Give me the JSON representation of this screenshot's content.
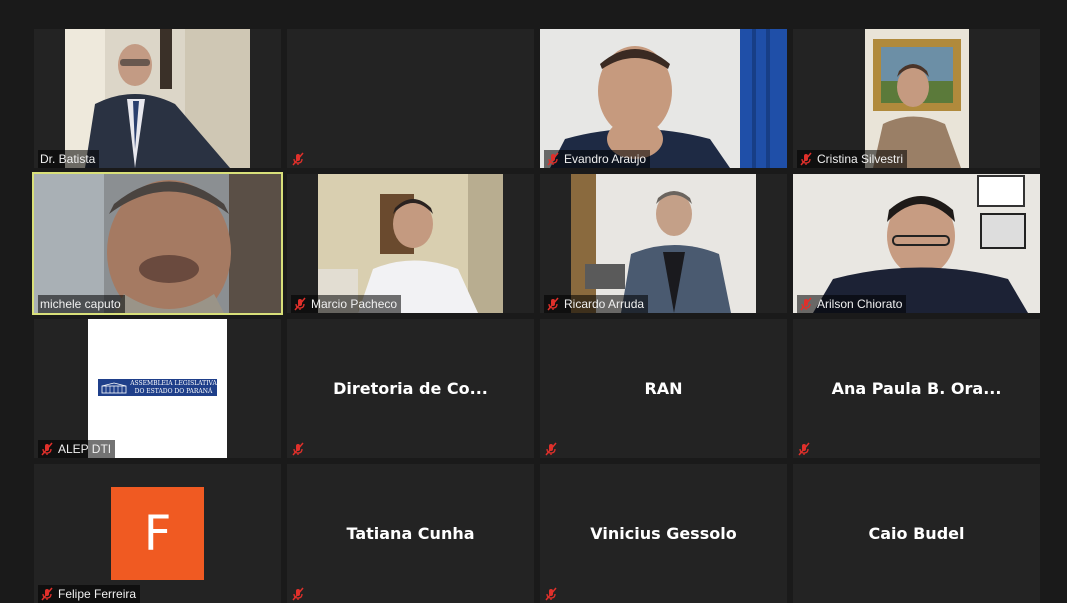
{
  "participants": [
    {
      "name": "Dr. Batista",
      "video": true,
      "muted": false
    },
    {
      "name": "",
      "video": false,
      "muted": true
    },
    {
      "name": "Evandro Araujo",
      "video": true,
      "muted": true
    },
    {
      "name": "Cristina Silvestri",
      "video": true,
      "muted": true
    },
    {
      "name": "michele caputo",
      "video": true,
      "muted": false,
      "speaking": true
    },
    {
      "name": "Marcio Pacheco",
      "video": true,
      "muted": true
    },
    {
      "name": "Ricardo Arruda",
      "video": true,
      "muted": true
    },
    {
      "name": "Arilson Chiorato",
      "video": true,
      "muted": true
    },
    {
      "name": "ALEP DTI",
      "video": true,
      "muted": true,
      "logo_text": "ASSEMBLEIA LEGISLATIVA DO ESTADO DO PARANÁ"
    },
    {
      "name": "Diretoria de Co...",
      "video": false,
      "muted": true
    },
    {
      "name": "RAN",
      "video": false,
      "muted": true
    },
    {
      "name": "Ana Paula B. Ora...",
      "video": false,
      "muted": true
    },
    {
      "name": "Felipe Ferreira",
      "video": false,
      "muted": true,
      "avatar_letter": "F",
      "avatar_color": "#f05a22"
    },
    {
      "name": "Tatiana Cunha",
      "video": false,
      "muted": true
    },
    {
      "name": "Vinicius Gessolo",
      "video": false,
      "muted": true
    },
    {
      "name": "Caio Budel",
      "video": false,
      "muted": true
    }
  ],
  "colors": {
    "active_speaker_border": "#d9e07a",
    "muted_icon": "#e0302b",
    "background": "#1a1a1a",
    "tile": "#232323"
  }
}
